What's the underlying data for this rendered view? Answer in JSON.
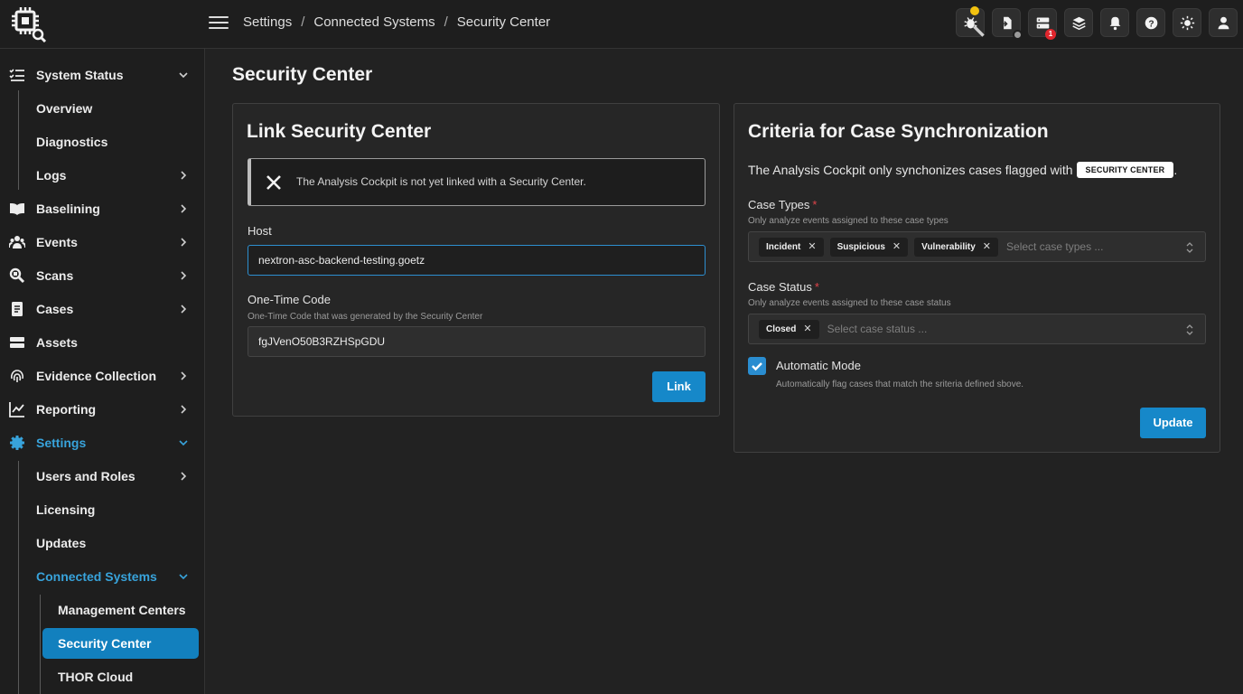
{
  "breadcrumb": {
    "item1": "Settings",
    "item2": "Connected Systems",
    "item3": "Security Center",
    "separator": "/"
  },
  "top_icons": {
    "icon1": "bug-icon",
    "icon2": "file-import-icon",
    "icon3": "server-icon",
    "icon4": "layers-icon",
    "icon5": "bell-icon",
    "icon6": "help-icon",
    "icon7": "sun-icon",
    "icon8": "user-icon",
    "server_badge": "1"
  },
  "sidebar": {
    "system_status": "System Status",
    "overview": "Overview",
    "diagnostics": "Diagnostics",
    "logs": "Logs",
    "baselining": "Baselining",
    "events": "Events",
    "scans": "Scans",
    "cases": "Cases",
    "assets": "Assets",
    "evidence_collection": "Evidence Collection",
    "reporting": "Reporting",
    "settings": "Settings",
    "users_and_roles": "Users and Roles",
    "licensing": "Licensing",
    "updates": "Updates",
    "connected_systems": "Connected Systems",
    "management_centers": "Management Centers",
    "security_center": "Security Center",
    "thor_cloud": "THOR Cloud"
  },
  "page": {
    "title": "Security Center"
  },
  "link_card": {
    "title": "Link Security Center",
    "alert": "The Analysis Cockpit is not yet linked with a Security Center.",
    "host_label": "Host",
    "host_value": "nextron-asc-backend-testing.goetz",
    "otc_label": "One-Time Code",
    "otc_help": "One-Time Code that was generated by the Security Center",
    "otc_value": "fgJVenO50B3RZHSpGDU",
    "link_button": "Link"
  },
  "criteria_card": {
    "title": "Criteria for Case Synchronization",
    "sync_text": "The Analysis Cockpit only synchonizes cases flagged with",
    "sync_badge": "SECURITY CENTER",
    "sync_end": ".",
    "case_types_label": "Case Types",
    "case_types_help": "Only analyze events assigned to these case types",
    "case_types": [
      "Incident",
      "Suspicious",
      "Vulnerability"
    ],
    "case_types_placeholder": "Select case types ...",
    "case_status_label": "Case Status",
    "case_status_help": "Only analyze events assigned to these case status",
    "case_status": [
      "Closed"
    ],
    "case_status_placeholder": "Select case status ...",
    "required_mark": "*",
    "auto_mode_label": "Automatic Mode",
    "auto_mode_help": "Automatically flag cases that match the sriteria defined sbove.",
    "auto_mode_checked": true,
    "update_button": "Update"
  },
  "colors": {
    "accent": "#1688c9",
    "active_text": "#38a3db",
    "background": "#222222",
    "required": "#e0444a"
  }
}
